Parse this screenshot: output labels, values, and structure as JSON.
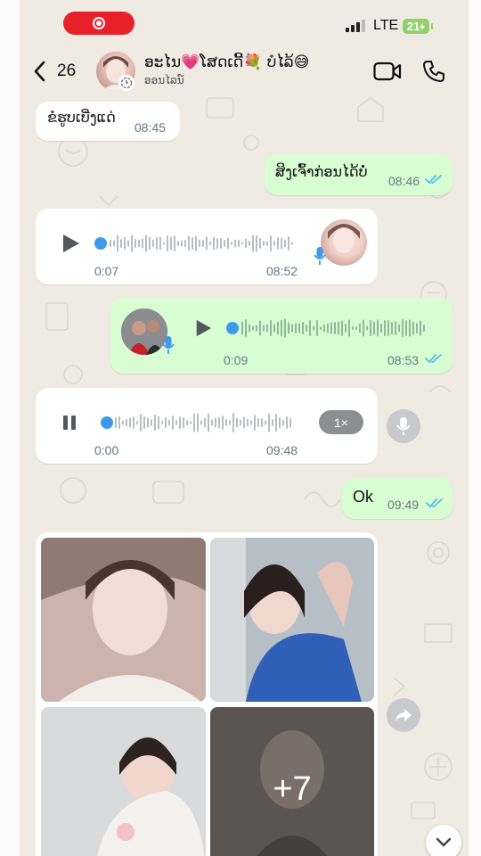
{
  "status_bar": {
    "recording_icon": "screen-record-icon",
    "network": "LTE",
    "battery": "21",
    "battery_charging": true
  },
  "header": {
    "back_count": "26",
    "contact_name": "ອະໄນ💗ໂສດເດີ້💐 ບໍໄລ້😅",
    "contact_status": "ອອນໄລນ໌",
    "icons": [
      "chevron-left-icon",
      "video-call-icon",
      "phone-icon"
    ]
  },
  "messages": [
    {
      "type": "text",
      "direction": "in",
      "text": "ຂໍຮູບເບີ່ງແດ່",
      "time": "08:45"
    },
    {
      "type": "text",
      "direction": "out",
      "text": "ສິງເຈົ້າກ່ອນໄດ້ບໍ່",
      "time": "08:46",
      "read": true
    },
    {
      "type": "voice",
      "direction": "in",
      "duration": "0:07",
      "time": "08:52",
      "progress": 0.0,
      "state": "paused"
    },
    {
      "type": "voice",
      "direction": "out",
      "duration": "0:09",
      "time": "08:53",
      "progress": 0.0,
      "state": "paused",
      "read": true
    },
    {
      "type": "voice",
      "direction": "in",
      "duration": "0:00",
      "time": "09:48",
      "progress": 0.02,
      "state": "playing",
      "speed": "1×"
    },
    {
      "type": "text",
      "direction": "out",
      "text": "Ok",
      "time": "09:49",
      "read": true
    },
    {
      "type": "album",
      "direction": "in",
      "photo_count_visible": 4,
      "more_label": "+7"
    }
  ],
  "colors": {
    "chat_background": "#efeae2",
    "incoming_bubble": "#ffffff",
    "outgoing_bubble": "#d9fdd3",
    "read_ticks": "#53bdeb",
    "record_pill": "#e8202a",
    "battery": "#8fd16a"
  }
}
